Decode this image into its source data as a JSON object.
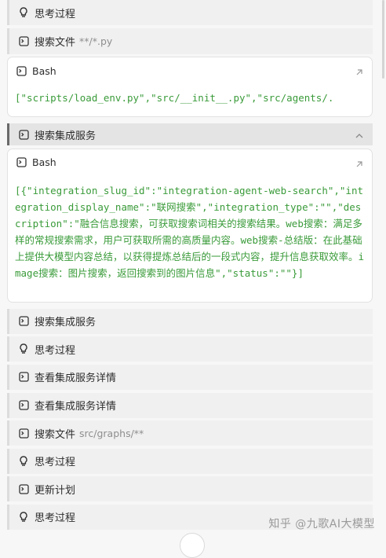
{
  "steps": [
    {
      "label": "思考过程",
      "icon": "bulb-icon"
    },
    {
      "label": "搜索文件",
      "sub": "**/*.py",
      "icon": "terminal-icon"
    },
    {
      "card": true,
      "title": "Bash",
      "icon": "terminal-icon",
      "output": "[\"scripts/load_env.py\",\"src/__init__.py\",\"src/agents/."
    },
    {
      "label": "搜索集成服务",
      "icon": "terminal-icon",
      "expanded": true
    },
    {
      "card": true,
      "title": "Bash",
      "icon": "terminal-icon",
      "output": "[{\"integration_slug_id\":\"integration-agent-web-search\",\"integration_display_name\":\"联网搜索\",\"integration_type\":\"\",\"description\":\"融合信息搜索，可获取搜索词相关的搜索结果。web搜索：满足多样的常规搜索需求，用户可获取所需的高质量内容。web搜索-总结版：在此基础上提供大模型内容总结，以获得提炼总结后的一段式内容，提升信息获取效率。image搜索：图片搜索，返回搜索到的图片信息\",\"status\":\"\"}]"
    },
    {
      "label": "搜索集成服务",
      "icon": "terminal-icon"
    },
    {
      "label": "思考过程",
      "icon": "bulb-icon"
    },
    {
      "label": "查看集成服务详情",
      "icon": "terminal-icon"
    },
    {
      "label": "查看集成服务详情",
      "icon": "terminal-icon"
    },
    {
      "label": "搜索文件",
      "sub": "src/graphs/**",
      "icon": "terminal-icon"
    },
    {
      "label": "思考过程",
      "icon": "bulb-icon"
    },
    {
      "label": "更新计划",
      "icon": "terminal-icon"
    },
    {
      "label": "思考过程",
      "icon": "bulb-icon"
    }
  ],
  "watermark": "知乎 @九歌AI大模型",
  "colors": {
    "code": "#3a9b3a",
    "row_bg": "#f0f0f0",
    "active_border": "#6a6a6a"
  }
}
